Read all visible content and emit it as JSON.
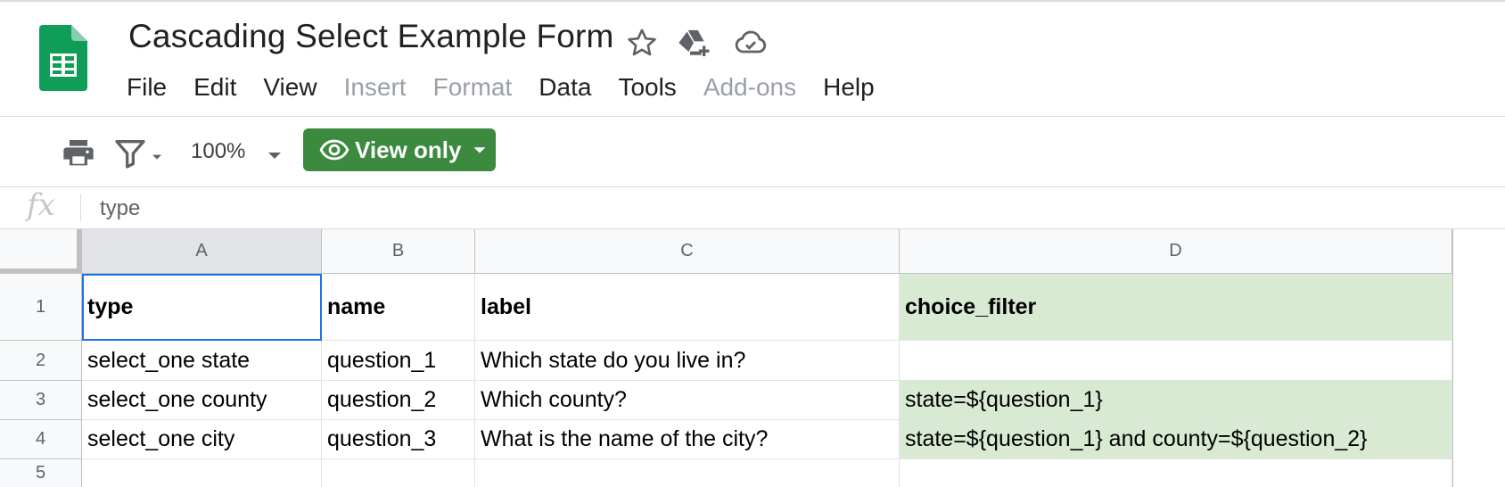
{
  "app": {
    "title": "Cascading Select Example Form",
    "logo_icon": "google-sheets-logo",
    "header_icons": [
      "star-icon",
      "move-to-drive-icon",
      "cloud-saved-icon"
    ]
  },
  "menu": [
    {
      "label": "File",
      "enabled": true
    },
    {
      "label": "Edit",
      "enabled": true
    },
    {
      "label": "View",
      "enabled": true
    },
    {
      "label": "Insert",
      "enabled": false
    },
    {
      "label": "Format",
      "enabled": false
    },
    {
      "label": "Data",
      "enabled": true
    },
    {
      "label": "Tools",
      "enabled": true
    },
    {
      "label": "Add-ons",
      "enabled": false
    },
    {
      "label": "Help",
      "enabled": true
    }
  ],
  "toolbar": {
    "zoom": "100%",
    "view_mode_label": "View only"
  },
  "formula_bar": {
    "fx_label": "fx",
    "value": "type"
  },
  "sheet": {
    "columns": [
      "A",
      "B",
      "C",
      "D"
    ],
    "rows": [
      "1",
      "2",
      "3",
      "4",
      "5"
    ],
    "cells": [
      [
        "type",
        "name",
        "label",
        "choice_filter"
      ],
      [
        "select_one state",
        "question_1",
        "Which state do you live in?",
        ""
      ],
      [
        "select_one county",
        "question_2",
        "Which county?",
        "state=${question_1}"
      ],
      [
        "select_one city",
        "question_3",
        "What is the name of the city?",
        "state=${question_1} and county=${question_2}"
      ],
      [
        "",
        "",
        "",
        ""
      ]
    ],
    "selected_cell": "A1",
    "colors": {
      "highlight": "#d9ead3",
      "selection": "#1a73e8",
      "view_only_button": "#3b8a3e",
      "logo_green": "#0f9d58"
    }
  }
}
